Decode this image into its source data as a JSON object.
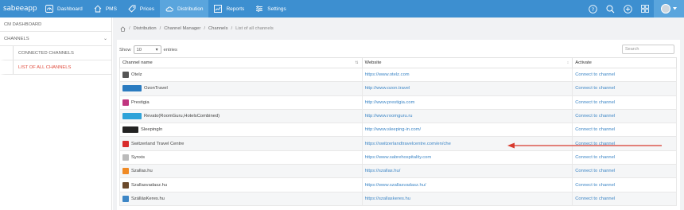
{
  "brand": "sabeeapp",
  "nav": [
    {
      "label": "Dashboard",
      "icon": "gauge-icon",
      "active": false
    },
    {
      "label": "PMS",
      "icon": "home-icon",
      "active": false
    },
    {
      "label": "Prices",
      "icon": "tag-icon",
      "active": false
    },
    {
      "label": "Distribution",
      "icon": "cloud-icon",
      "active": true
    },
    {
      "label": "Reports",
      "icon": "chart-icon",
      "active": false
    },
    {
      "label": "Settings",
      "icon": "sliders-icon",
      "active": false
    }
  ],
  "sidebar": {
    "cm_dashboard": "CM DASHBOARD",
    "channels": "CHANNELS",
    "connected": "CONNECTED CHANNELS",
    "list_all": "LIST OF ALL CHANNELS"
  },
  "breadcrumb": [
    "Distribution",
    "Channel Manager",
    "Channels",
    "List of all channels"
  ],
  "table_controls": {
    "show": "Show",
    "entries": "entries",
    "page_size": "10",
    "search_placeholder": "Search"
  },
  "columns": [
    "Channel name",
    "Website",
    "Activate"
  ],
  "rows": [
    {
      "name": "Otelz",
      "website": "https://www.otelz.com",
      "action": "Connect to channel",
      "logo_color": "#555"
    },
    {
      "name": "OzonTravel",
      "website": "http://www.ozon.travel",
      "action": "Connect to channel",
      "logo_color": "#2a7bc0"
    },
    {
      "name": "Prestigia",
      "website": "http://www.prestigia.com",
      "action": "Connect to channel",
      "logo_color": "#c0357f"
    },
    {
      "name": "Revato(RoomGuru,HotelsCombined)",
      "website": "http://www.roomguru.ru",
      "action": "Connect to channel",
      "logo_color": "#2fa3d9"
    },
    {
      "name": "SleepingIn",
      "website": "http://www.sleeping-in.com/",
      "action": "Connect to channel",
      "logo_color": "#222"
    },
    {
      "name": "Switzerland Travel Centre",
      "website": "https://switzerlandtravelcentre.com/en/che",
      "action": "Connect to channel",
      "logo_color": "#d82b2b"
    },
    {
      "name": "Synxis",
      "website": "https://www.sabrehospitality.com",
      "action": "Connect to channel",
      "logo_color": "#bbb"
    },
    {
      "name": "Szallas.hu",
      "website": "https://szallas.hu/",
      "action": "Connect to channel",
      "logo_color": "#f08a24"
    },
    {
      "name": "Szallasvadasz.hu",
      "website": "https://www.szallasvadasz.hu/",
      "action": "Connect to channel",
      "logo_color": "#6b4a2b"
    },
    {
      "name": "SzállásKeres.hu",
      "website": "https://szallaskeres.hu",
      "action": "Connect to channel",
      "logo_color": "#3d86c6"
    }
  ],
  "colors": {
    "topbar": "#3d8fd0",
    "active_nav": "#5aa5dd",
    "link": "#3d86c6",
    "accent_red": "#e04b3d"
  }
}
